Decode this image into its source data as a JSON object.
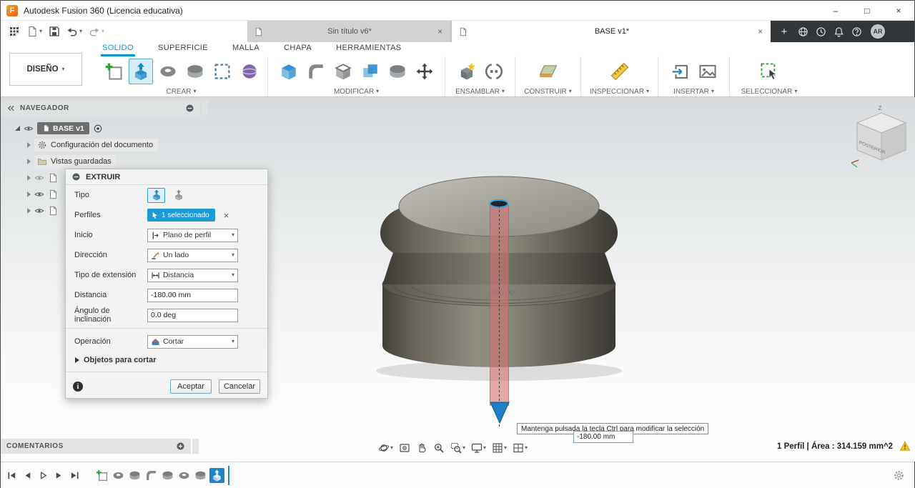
{
  "titlebar": {
    "title": "Autodesk Fusion 360 (Licencia educativa)",
    "minimize": "–",
    "maximize": "□",
    "close": "×"
  },
  "icons": {
    "caret_down": "▾",
    "close": "×",
    "plus": "+"
  },
  "doc_tabs": {
    "inactive_label": "Sin título v6*",
    "active_label": "BASE v1*"
  },
  "account": {
    "initials": "AR"
  },
  "ribbon": {
    "workspace": "DISEÑO",
    "tabs": [
      {
        "label": "SOLIDO"
      },
      {
        "label": "SUPERFICIE"
      },
      {
        "label": "MALLA"
      },
      {
        "label": "CHAPA"
      },
      {
        "label": "HERRAMIENTAS"
      }
    ],
    "groups": [
      {
        "label": "CREAR"
      },
      {
        "label": "MODIFICAR"
      },
      {
        "label": "ENSAMBLAR"
      },
      {
        "label": "CONSTRUIR"
      },
      {
        "label": "INSPECCIONAR"
      },
      {
        "label": "INSERTAR"
      },
      {
        "label": "SELECCIONAR"
      }
    ]
  },
  "navigator": {
    "title": "NAVEGADOR",
    "root_label": "BASE v1",
    "item_document_settings": "Configuración del documento",
    "item_saved_views": "Vistas guardadas"
  },
  "dialog": {
    "title": "EXTRUIR",
    "labels": {
      "tipo": "Tipo",
      "perfiles": "Perfiles",
      "inicio": "Inicio",
      "direccion": "Dirección",
      "extension": "Tipo de extensión",
      "distancia": "Distancia",
      "angulo": "Ángulo de inclinación",
      "operacion": "Operación",
      "objetos": "Objetos para cortar"
    },
    "values": {
      "perfiles_chip": "1 seleccionado",
      "inicio": "Plano de perfil",
      "direccion": "Un lado",
      "extension": "Distancia",
      "distancia": "-180.00 mm",
      "angulo": "0.0 deg",
      "operacion": "Cortar"
    },
    "buttons": {
      "ok": "Aceptar",
      "cancel": "Cancelar"
    }
  },
  "viewport": {
    "faint_dimension": "-180.00",
    "dimension_value": "-180.00 mm",
    "tooltip": "Mantenga pulsada la tecla Ctrl para modificar la selección",
    "viewcube_face": "POSTERIOR",
    "axis_z": "Z"
  },
  "comments": {
    "title": "COMENTARIOS"
  },
  "status": {
    "selection": "1 Perfil | Área : 314.159 mm^2"
  },
  "colors": {
    "accent_blue": "#0696d7",
    "selection_chip": "#1d9bd8",
    "preview_red": "#d4706e",
    "warning_yellow": "#f6c21d"
  }
}
